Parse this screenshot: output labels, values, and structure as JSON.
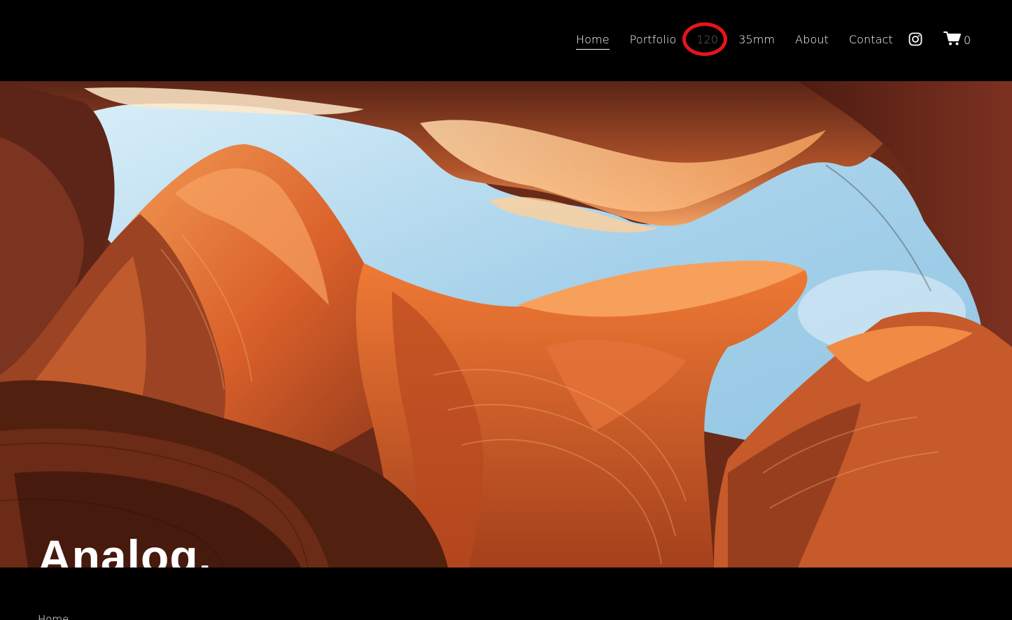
{
  "nav": {
    "items": [
      {
        "label": "Home",
        "active": true
      },
      {
        "label": "Portfolio",
        "active": false
      },
      {
        "label": "120",
        "active": false
      },
      {
        "label": "35mm",
        "active": false
      },
      {
        "label": "About",
        "active": false
      },
      {
        "label": "Contact",
        "active": false
      }
    ]
  },
  "social": {
    "icon": "instagram-icon"
  },
  "cart": {
    "icon": "cart-icon",
    "count": "0"
  },
  "hero": {
    "title": "Analog."
  },
  "breadcrumb": {
    "label": "Home"
  },
  "colors": {
    "background": "#000000",
    "text": "#ffffff",
    "annotation": "#e8141b",
    "sky": "#a9d3ea",
    "rock_orange": "#e0662a",
    "rock_dark": "#5c2416"
  }
}
